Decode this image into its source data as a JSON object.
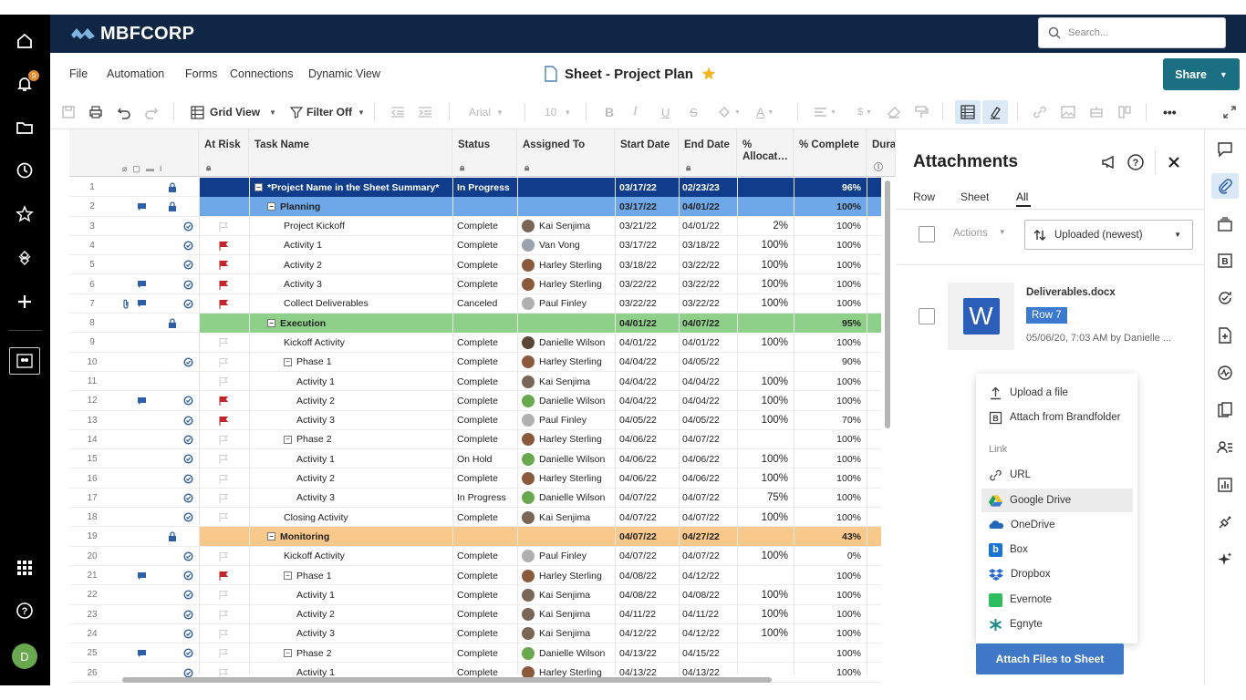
{
  "app": {
    "logo": "MBFCORP",
    "search_placeholder": "Search...",
    "notification_count": "9",
    "user_initial": "D"
  },
  "menu": {
    "file": "File",
    "automation": "Automation",
    "forms": "Forms",
    "connections": "Connections",
    "dynamic_view": "Dynamic View"
  },
  "sheet_title": "Sheet - Project Plan",
  "share": {
    "label": "Share"
  },
  "toolbar": {
    "grid_view": "Grid View",
    "filter": "Filter Off",
    "font": "Arial",
    "font_size": "10"
  },
  "columns": {
    "at_risk": "At Risk",
    "task_name": "Task Name",
    "status": "Status",
    "assigned_to": "Assigned To",
    "start_date": "Start Date",
    "end_date": "End Date",
    "pct_alloc": "% Allocat…",
    "pct_complete": "% Complete",
    "duration": "Dura"
  },
  "rows": [
    {
      "n": "1",
      "task": "*Project Name in the Sheet Summary*",
      "status": "In Progress",
      "assigned": "",
      "start": "03/17/22",
      "end": "02/23/23",
      "alloc": "",
      "complete": "96%",
      "type": "project",
      "indent": 0,
      "toggle": true,
      "lock": true,
      "comment": false,
      "attach": false,
      "sync": false,
      "flag": "none",
      "av": ""
    },
    {
      "n": "2",
      "task": "Planning",
      "status": "",
      "assigned": "",
      "start": "03/17/22",
      "end": "04/01/22",
      "alloc": "",
      "complete": "100%",
      "type": "planning",
      "indent": 1,
      "toggle": true,
      "lock": true,
      "comment": true,
      "attach": false,
      "sync": false,
      "flag": "none",
      "av": ""
    },
    {
      "n": "3",
      "task": "Project Kickoff",
      "status": "Complete",
      "assigned": "Kai Senjima",
      "start": "03/21/22",
      "end": "04/01/22",
      "alloc": "2%",
      "complete": "100%",
      "type": "task",
      "indent": 2,
      "toggle": false,
      "lock": false,
      "comment": false,
      "attach": false,
      "sync": true,
      "flag": "empty",
      "av": "#7a6656"
    },
    {
      "n": "4",
      "task": "Activity 1",
      "status": "Complete",
      "assigned": "Van Vong",
      "start": "03/17/22",
      "end": "03/18/22",
      "alloc": "100%",
      "complete": "100%",
      "type": "task",
      "indent": 2,
      "toggle": false,
      "lock": false,
      "comment": false,
      "attach": false,
      "sync": true,
      "flag": "red",
      "av": "#9aa2ad"
    },
    {
      "n": "5",
      "task": "Activity 2",
      "status": "Complete",
      "assigned": "Harley Sterling",
      "start": "03/18/22",
      "end": "03/22/22",
      "alloc": "100%",
      "complete": "100%",
      "type": "task",
      "indent": 2,
      "toggle": false,
      "lock": false,
      "comment": false,
      "attach": false,
      "sync": true,
      "flag": "red",
      "av": "#8b5a3c"
    },
    {
      "n": "6",
      "task": "Activity 3",
      "status": "Complete",
      "assigned": "Harley Sterling",
      "start": "03/22/22",
      "end": "03/22/22",
      "alloc": "100%",
      "complete": "100%",
      "type": "task",
      "indent": 2,
      "toggle": false,
      "lock": false,
      "comment": true,
      "attach": false,
      "sync": true,
      "flag": "red",
      "av": "#8b5a3c"
    },
    {
      "n": "7",
      "task": "Collect Deliverables",
      "status": "Canceled",
      "assigned": "Paul Finley",
      "start": "03/22/22",
      "end": "03/22/22",
      "alloc": "100%",
      "complete": "100%",
      "type": "task",
      "indent": 2,
      "toggle": false,
      "lock": false,
      "comment": true,
      "attach": true,
      "sync": true,
      "flag": "red",
      "av": "#b0b0b0"
    },
    {
      "n": "8",
      "task": "Execution",
      "status": "",
      "assigned": "",
      "start": "04/01/22",
      "end": "04/07/22",
      "alloc": "",
      "complete": "95%",
      "type": "execution",
      "indent": 1,
      "toggle": true,
      "lock": true,
      "comment": false,
      "attach": false,
      "sync": false,
      "flag": "none",
      "av": ""
    },
    {
      "n": "9",
      "task": "Kickoff Activity",
      "status": "Complete",
      "assigned": "Danielle Wilson",
      "start": "04/01/22",
      "end": "04/01/22",
      "alloc": "100%",
      "complete": "100%",
      "type": "task",
      "indent": 2,
      "toggle": false,
      "lock": false,
      "comment": false,
      "attach": false,
      "sync": false,
      "flag": "empty",
      "av": "#5b4636"
    },
    {
      "n": "10",
      "task": "Phase 1",
      "status": "Complete",
      "assigned": "Harley Sterling",
      "start": "04/04/22",
      "end": "04/05/22",
      "alloc": "",
      "complete": "90%",
      "type": "task",
      "indent": 2,
      "toggle": true,
      "lock": false,
      "comment": false,
      "attach": false,
      "sync": true,
      "flag": "empty",
      "av": "#8b5a3c"
    },
    {
      "n": "11",
      "task": "Activity 1",
      "status": "Complete",
      "assigned": "Kai Senjima",
      "start": "04/04/22",
      "end": "04/04/22",
      "alloc": "100%",
      "complete": "100%",
      "type": "task",
      "indent": 3,
      "toggle": false,
      "lock": false,
      "comment": false,
      "attach": false,
      "sync": false,
      "flag": "empty",
      "av": "#7a6656"
    },
    {
      "n": "12",
      "task": "Activity 2",
      "status": "Complete",
      "assigned": "Danielle Wilson",
      "start": "04/04/22",
      "end": "04/04/22",
      "alloc": "100%",
      "complete": "100%",
      "type": "task",
      "indent": 3,
      "toggle": false,
      "lock": false,
      "comment": true,
      "attach": false,
      "sync": true,
      "flag": "red",
      "av": "#6aa84f"
    },
    {
      "n": "13",
      "task": "Activity 3",
      "status": "Complete",
      "assigned": "Paul Finley",
      "start": "04/05/22",
      "end": "04/05/22",
      "alloc": "100%",
      "complete": "70%",
      "type": "task",
      "indent": 3,
      "toggle": false,
      "lock": false,
      "comment": false,
      "attach": false,
      "sync": true,
      "flag": "red",
      "av": "#b0b0b0"
    },
    {
      "n": "14",
      "task": "Phase 2",
      "status": "Complete",
      "assigned": "Harley Sterling",
      "start": "04/06/22",
      "end": "04/07/22",
      "alloc": "",
      "complete": "100%",
      "type": "task",
      "indent": 2,
      "toggle": true,
      "lock": false,
      "comment": false,
      "attach": false,
      "sync": true,
      "flag": "empty",
      "av": "#8b5a3c"
    },
    {
      "n": "15",
      "task": "Activity 1",
      "status": "On Hold",
      "assigned": "Danielle Wilson",
      "start": "04/06/22",
      "end": "04/06/22",
      "alloc": "100%",
      "complete": "100%",
      "type": "task",
      "indent": 3,
      "toggle": false,
      "lock": false,
      "comment": false,
      "attach": false,
      "sync": true,
      "flag": "empty",
      "av": "#6aa84f"
    },
    {
      "n": "16",
      "task": "Activity 2",
      "status": "Complete",
      "assigned": "Harley Sterling",
      "start": "04/06/22",
      "end": "04/06/22",
      "alloc": "100%",
      "complete": "100%",
      "type": "task",
      "indent": 3,
      "toggle": false,
      "lock": false,
      "comment": false,
      "attach": false,
      "sync": true,
      "flag": "empty",
      "av": "#8b5a3c"
    },
    {
      "n": "17",
      "task": "Activity 3",
      "status": "In Progress",
      "assigned": "Danielle Wilson",
      "start": "04/07/22",
      "end": "04/07/22",
      "alloc": "75%",
      "complete": "100%",
      "type": "task",
      "indent": 3,
      "toggle": false,
      "lock": false,
      "comment": false,
      "attach": false,
      "sync": true,
      "flag": "empty",
      "av": "#6aa84f"
    },
    {
      "n": "18",
      "task": "Closing Activity",
      "status": "Complete",
      "assigned": "Kai Senjima",
      "start": "04/07/22",
      "end": "04/07/22",
      "alloc": "100%",
      "complete": "100%",
      "type": "task",
      "indent": 2,
      "toggle": false,
      "lock": false,
      "comment": false,
      "attach": false,
      "sync": true,
      "flag": "empty",
      "av": "#7a6656"
    },
    {
      "n": "19",
      "task": "Monitoring",
      "status": "",
      "assigned": "",
      "start": "04/07/22",
      "end": "04/27/22",
      "alloc": "",
      "complete": "43%",
      "type": "monitoring",
      "indent": 1,
      "toggle": true,
      "lock": true,
      "comment": false,
      "attach": false,
      "sync": false,
      "flag": "none",
      "av": ""
    },
    {
      "n": "20",
      "task": "Kickoff Activity",
      "status": "Complete",
      "assigned": "Paul Finley",
      "start": "04/07/22",
      "end": "04/07/22",
      "alloc": "100%",
      "complete": "0%",
      "type": "task",
      "indent": 2,
      "toggle": false,
      "lock": false,
      "comment": false,
      "attach": false,
      "sync": true,
      "flag": "empty",
      "av": "#b0b0b0"
    },
    {
      "n": "21",
      "task": "Phase 1",
      "status": "Complete",
      "assigned": "Harley Sterling",
      "start": "04/08/22",
      "end": "04/12/22",
      "alloc": "",
      "complete": "100%",
      "type": "task",
      "indent": 2,
      "toggle": true,
      "lock": false,
      "comment": true,
      "attach": false,
      "sync": true,
      "flag": "red",
      "av": "#8b5a3c"
    },
    {
      "n": "22",
      "task": "Activity 1",
      "status": "Complete",
      "assigned": "Kai Senjima",
      "start": "04/08/22",
      "end": "04/08/22",
      "alloc": "100%",
      "complete": "100%",
      "type": "task",
      "indent": 3,
      "toggle": false,
      "lock": false,
      "comment": false,
      "attach": false,
      "sync": true,
      "flag": "empty",
      "av": "#7a6656"
    },
    {
      "n": "23",
      "task": "Activity 2",
      "status": "Complete",
      "assigned": "Kai Senjima",
      "start": "04/11/22",
      "end": "04/11/22",
      "alloc": "100%",
      "complete": "100%",
      "type": "task",
      "indent": 3,
      "toggle": false,
      "lock": false,
      "comment": false,
      "attach": false,
      "sync": true,
      "flag": "empty",
      "av": "#7a6656"
    },
    {
      "n": "24",
      "task": "Activity 3",
      "status": "Complete",
      "assigned": "Kai Senjima",
      "start": "04/12/22",
      "end": "04/12/22",
      "alloc": "100%",
      "complete": "100%",
      "type": "task",
      "indent": 3,
      "toggle": false,
      "lock": false,
      "comment": false,
      "attach": false,
      "sync": true,
      "flag": "empty",
      "av": "#7a6656"
    },
    {
      "n": "25",
      "task": "Phase 2",
      "status": "Complete",
      "assigned": "Danielle Wilson",
      "start": "04/13/22",
      "end": "04/15/22",
      "alloc": "",
      "complete": "100%",
      "type": "task",
      "indent": 2,
      "toggle": true,
      "lock": false,
      "comment": true,
      "attach": false,
      "sync": true,
      "flag": "empty",
      "av": "#6aa84f"
    },
    {
      "n": "26",
      "task": "Activity 1",
      "status": "Complete",
      "assigned": "Harley Sterling",
      "start": "04/13/22",
      "end": "04/13/22",
      "alloc": "",
      "complete": "100%",
      "type": "task",
      "indent": 3,
      "toggle": false,
      "lock": false,
      "comment": false,
      "attach": false,
      "sync": true,
      "flag": "empty",
      "av": "#8b5a3c"
    }
  ],
  "panel": {
    "title": "Attachments",
    "tabs": [
      "Row",
      "Sheet",
      "All"
    ],
    "active_tab": "All",
    "actions": "Actions",
    "sort": "Uploaded (newest)",
    "file": {
      "name": "Deliverables.docx",
      "badge": "Row 7",
      "meta": "05/06/20, 7:03 AM by Danielle ...",
      "icon_letter": "W"
    }
  },
  "upload_menu": {
    "upload": "Upload a file",
    "brandfolder": "Attach from Brandfolder",
    "link_header": "Link",
    "url": "URL",
    "google_drive": "Google Drive",
    "onedrive": "OneDrive",
    "box": "Box",
    "dropbox": "Dropbox",
    "evernote": "Evernote",
    "egnyte": "Egnyte",
    "attach_button": "Attach Files to Sheet"
  },
  "colors": {
    "project_row": "#0f3d8c",
    "planning_row": "#6fa8e8",
    "execution_row": "#8ed08a",
    "monitoring_row": "#f8c98a",
    "header_bg": "#0f2745",
    "share": "#1b6f82",
    "attach_btn": "#3f78c7",
    "red_flag": "#c4262e"
  }
}
